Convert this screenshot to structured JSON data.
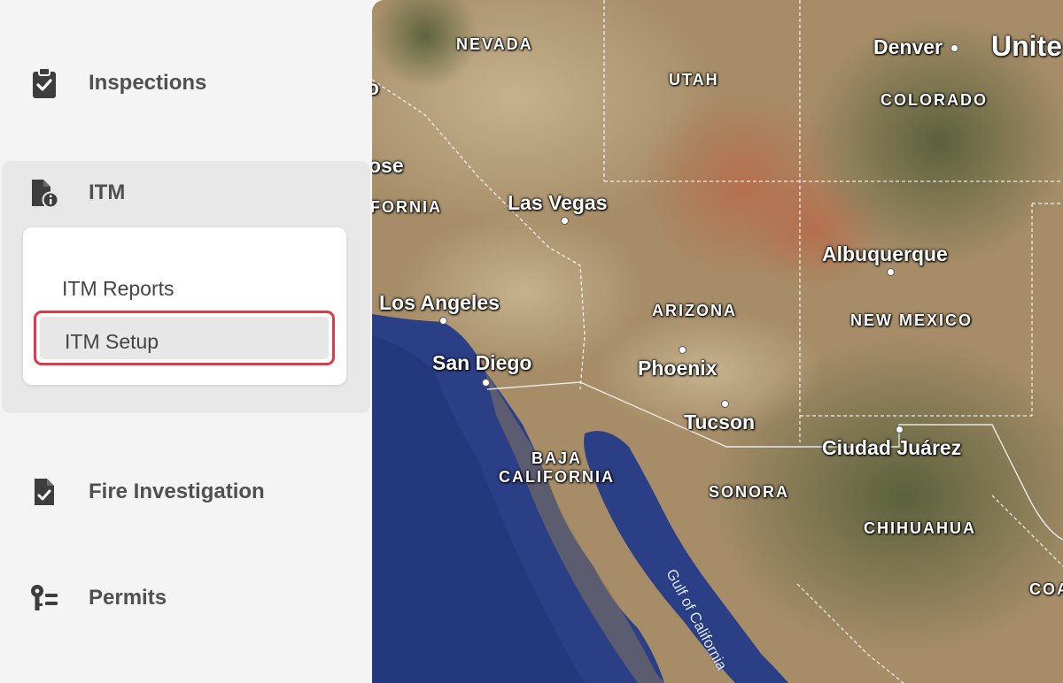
{
  "sidebar": {
    "items": [
      {
        "label": "Inspections",
        "icon": "clipboard-check-icon"
      },
      {
        "label": "ITM",
        "icon": "file-info-icon"
      },
      {
        "label": "Fire Investigation",
        "icon": "file-check-icon"
      },
      {
        "label": "Permits",
        "icon": "key-list-icon"
      }
    ],
    "itm_submenu": [
      {
        "label": "ITM Reports"
      },
      {
        "label": "ITM Setup",
        "highlighted": true
      }
    ]
  },
  "map": {
    "cities": [
      "Denver",
      "Las Vegas",
      "Albuquerque",
      "Los Angeles",
      "San Diego",
      "Phoenix",
      "Tucson",
      "Ciudad Juárez"
    ],
    "regions": [
      "NEVADA",
      "UTAH",
      "COLORADO",
      "ARIZONA",
      "NEW MEXICO",
      "BAJA",
      "CALIFORNIA",
      "SONORA",
      "CHIHUAHUA"
    ],
    "partial_labels": [
      "Unite",
      "ose",
      "FORNIA",
      "COA",
      "o"
    ],
    "water": "Gulf of California"
  },
  "colors": {
    "highlight_border": "#e0394b",
    "sidebar_bg": "#f4f4f4",
    "group_bg": "#e9e8e8"
  }
}
